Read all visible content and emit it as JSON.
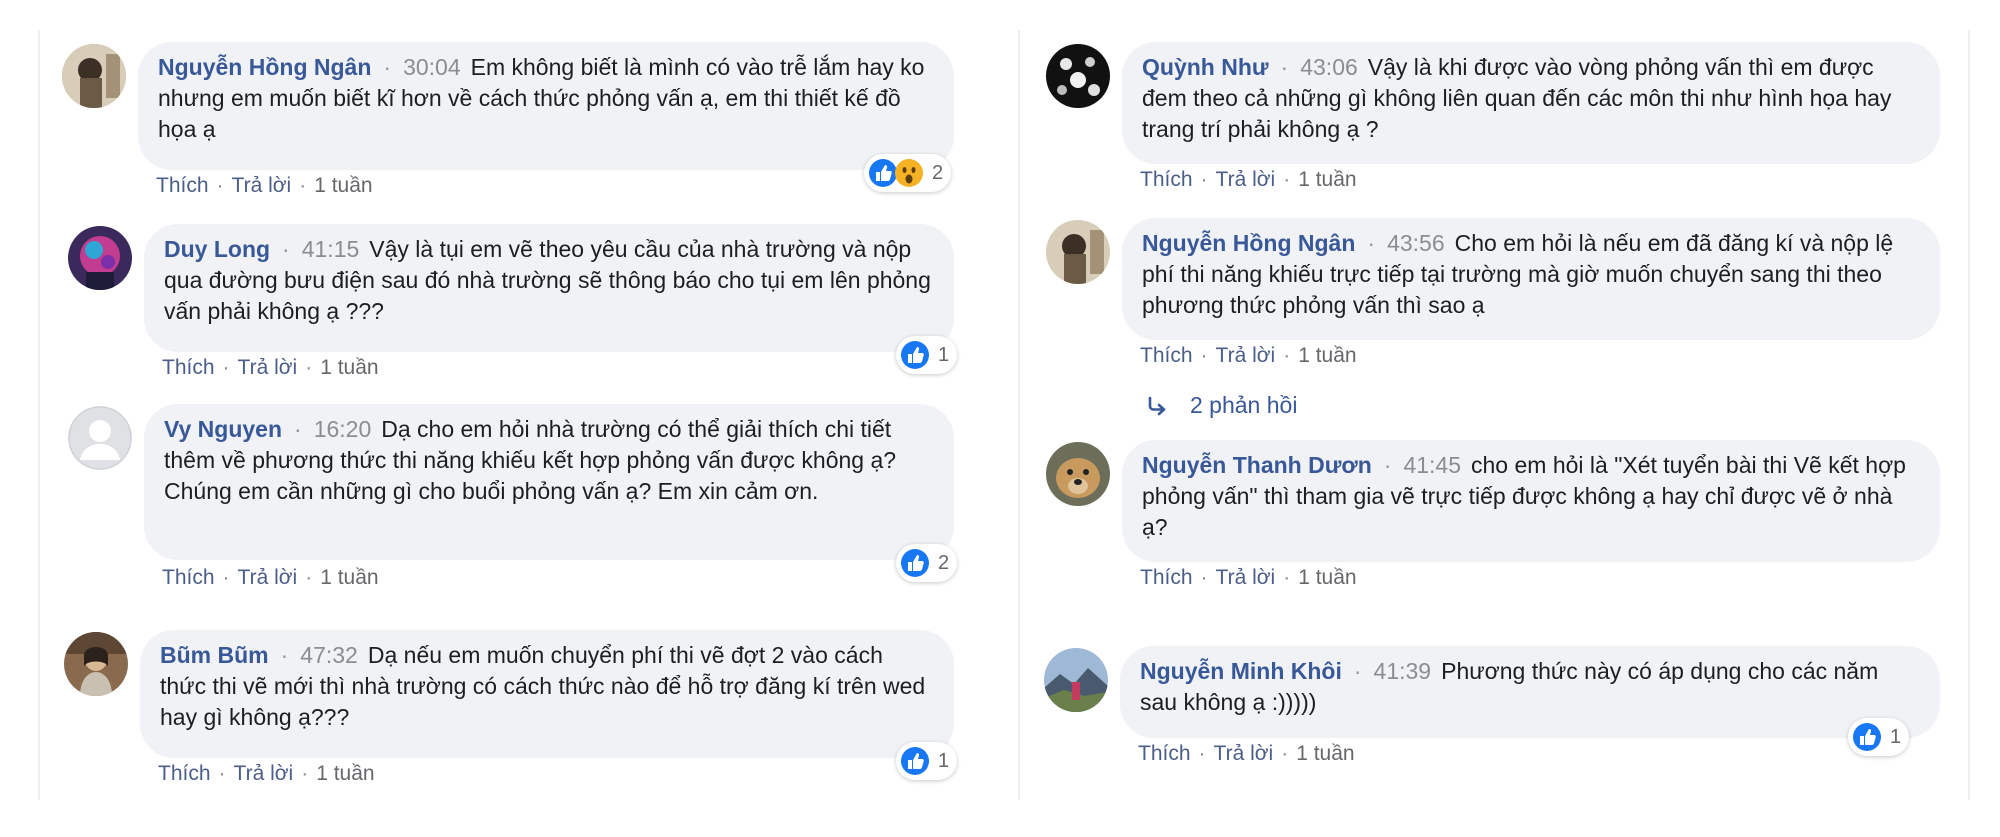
{
  "colors": {
    "author": "#385898",
    "bubble": "#f0f2f5",
    "like_blue": "#1877f2",
    "meta_grey": "#8a8d91"
  },
  "actions": {
    "like": "Thích",
    "reply": "Trả lời",
    "age": "1 tuần",
    "sep": "·"
  },
  "left": [
    {
      "author": "Nguyễn Hồng Ngân",
      "timestamp": "30:04",
      "text": "Em không biết là mình có vào trễ lắm hay ko nhưng em muốn biết kĩ hơn về cách thức phỏng vấn ạ, em thi thiết kế đồ họa ạ",
      "reactions": [
        "like-icon",
        "wow-icon"
      ],
      "reaction_count": "2"
    },
    {
      "author": "Duy Long",
      "timestamp": "41:15",
      "text": "Vậy là tụi em vẽ theo yêu cầu của nhà trường và nộp qua đường bưu điện sau đó nhà trường sẽ thông báo cho tụi em lên phỏng vấn phải không ạ ???",
      "reactions": [
        "like-icon"
      ],
      "reaction_count": "1"
    },
    {
      "author": "Vy Nguyen",
      "timestamp": "16:20",
      "text": "Dạ cho em hỏi nhà trường có thể giải thích chi tiết thêm về phương thức thi năng khiếu kết hợp phỏng vấn được không ạ? Chúng em cần những gì cho buổi phỏng vấn ạ? Em xin cảm ơn.",
      "reactions": [
        "like-icon"
      ],
      "reaction_count": "2"
    },
    {
      "author": "Bũm Bũm",
      "timestamp": "47:32",
      "text": "Dạ nếu em muốn chuyển phí thi vẽ đợt 2 vào cách thức thi vẽ mới thì nhà trường có cách thức nào để hỗ trợ đăng kí trên wed hay gì không ạ???",
      "reactions": [
        "like-icon"
      ],
      "reaction_count": "1"
    }
  ],
  "right": [
    {
      "author": "Quỳnh Như",
      "timestamp": "43:06",
      "text": "Vậy là khi được vào vòng phỏng vấn thì em được đem theo cả những gì không liên quan đến các môn thi như hình họa hay trang trí phải không ạ ?"
    },
    {
      "author": "Nguyễn Hồng Ngân",
      "timestamp": "43:56",
      "text": "Cho em hỏi là nếu em đã đăng kí và nộp lệ phí thi năng khiếu trực tiếp tại trường mà giờ muốn chuyển sang thi theo phương thức phỏng vấn thì sao ạ",
      "replies": "2 phản hồi"
    },
    {
      "author": "Nguyễn Thanh Dươn",
      "timestamp": "41:45",
      "text": "cho em hỏi là \"Xét tuyển bài thi Vẽ kết hợp phỏng vấn\" thì tham gia vẽ trực tiếp được không ạ hay chỉ được vẽ ở nhà ạ?"
    },
    {
      "author": "Nguyễn Minh Khôi",
      "timestamp": "41:39",
      "text": "Phương thức này có áp dụng cho các năm sau không ạ :)))))",
      "reactions": [
        "like-icon"
      ],
      "reaction_count": "1"
    }
  ]
}
